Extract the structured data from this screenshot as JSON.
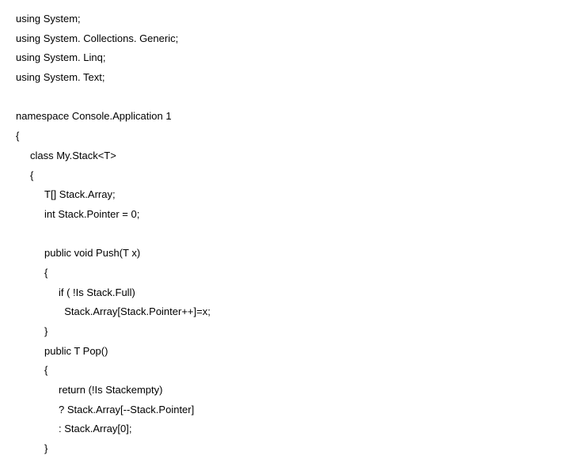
{
  "lines": [
    {
      "text": "using System;",
      "indent": 0
    },
    {
      "text": "using System. Collections. Generic;",
      "indent": 0
    },
    {
      "text": "using System. Linq;",
      "indent": 0
    },
    {
      "text": "using System. Text;",
      "indent": 0
    },
    {
      "text": "",
      "indent": 0
    },
    {
      "text": "namespace Console.Application 1",
      "indent": 0
    },
    {
      "text": "{",
      "indent": 0
    },
    {
      "text": "class My.Stack<T>",
      "indent": 1
    },
    {
      "text": "{",
      "indent": 1
    },
    {
      "text": "T[] Stack.Array;",
      "indent": 2
    },
    {
      "text": "int Stack.Pointer = 0;",
      "indent": 2
    },
    {
      "text": "",
      "indent": 2
    },
    {
      "text": "public void Push(T x)",
      "indent": 2
    },
    {
      "text": "{",
      "indent": 2
    },
    {
      "text": "if ( !Is Stack.Full)",
      "indent": 3
    },
    {
      "text": "  Stack.Array[Stack.Pointer++]=x;",
      "indent": 3
    },
    {
      "text": "}",
      "indent": 2
    },
    {
      "text": "public T Pop()",
      "indent": 2
    },
    {
      "text": "{",
      "indent": 2
    },
    {
      "text": "return (!Is Stackempty)",
      "indent": 3
    },
    {
      "text": "? Stack.Array[--Stack.Pointer]",
      "indent": 3
    },
    {
      "text": ": Stack.Array[0];",
      "indent": 3
    },
    {
      "text": "}",
      "indent": 2
    }
  ]
}
